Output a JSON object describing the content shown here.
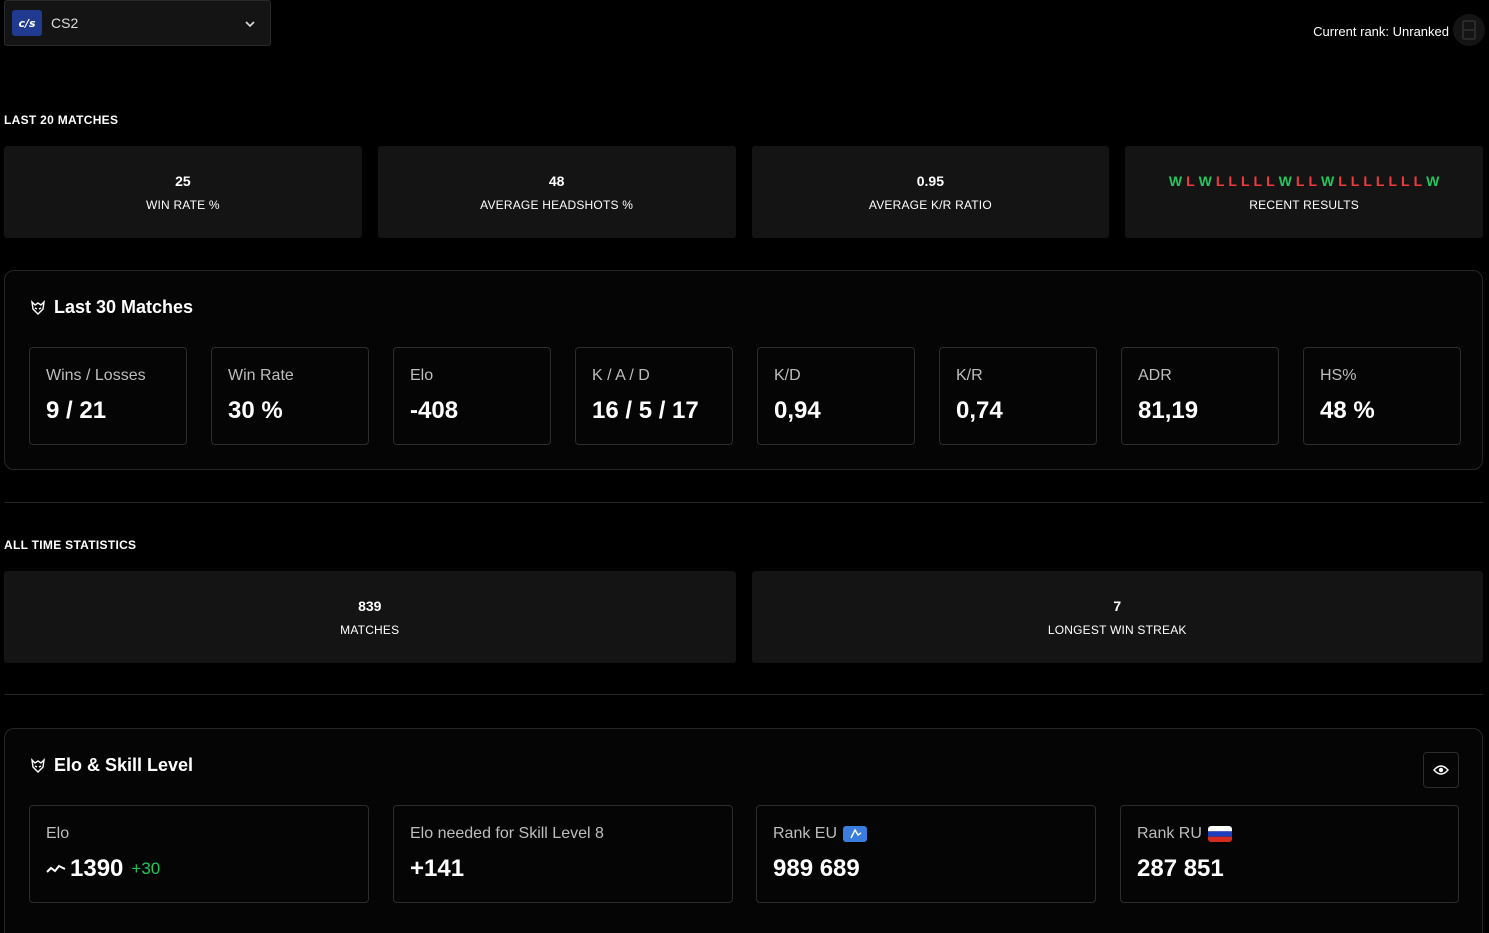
{
  "header": {
    "game_logo_text": "c/s",
    "game_name": "CS2",
    "current_rank_label": "Current rank: Unranked"
  },
  "last20": {
    "title": "LAST 20 MATCHES",
    "win_rate": {
      "value": "25",
      "label": "WIN RATE %"
    },
    "headshots": {
      "value": "48",
      "label": "AVERAGE HEADSHOTS %"
    },
    "kr_ratio": {
      "value": "0.95",
      "label": "AVERAGE K/R RATIO"
    },
    "recent": {
      "label": "RECENT RESULTS",
      "results": [
        "W",
        "L",
        "W",
        "L",
        "L",
        "L",
        "L",
        "L",
        "W",
        "L",
        "L",
        "W",
        "L",
        "L",
        "L",
        "L",
        "L",
        "L",
        "L",
        "W"
      ]
    }
  },
  "last30": {
    "title": "Last 30 Matches",
    "cards": [
      {
        "label": "Wins / Losses",
        "value": "9 / 21"
      },
      {
        "label": "Win Rate",
        "value": "30 %"
      },
      {
        "label": "Elo",
        "value": "-408"
      },
      {
        "label": "K / A / D",
        "value": "16 / 5 / 17"
      },
      {
        "label": "K/D",
        "value": "0,94"
      },
      {
        "label": "K/R",
        "value": "0,74"
      },
      {
        "label": "ADR",
        "value": "81,19"
      },
      {
        "label": "HS%",
        "value": "48 %"
      }
    ]
  },
  "alltime": {
    "title": "ALL TIME STATISTICS",
    "matches": {
      "value": "839",
      "label": "MATCHES"
    },
    "streak": {
      "value": "7",
      "label": "LONGEST WIN STREAK"
    }
  },
  "elo_skill": {
    "title": "Elo & Skill Level",
    "elo": {
      "label": "Elo",
      "value": "1390",
      "delta": "+30"
    },
    "needed": {
      "label": "Elo needed for Skill Level 8",
      "value": "+141"
    },
    "rank_eu": {
      "label": "Rank EU",
      "value": "989 689"
    },
    "rank_ru": {
      "label": "Rank RU",
      "value": "287 851"
    }
  },
  "colors": {
    "win": "#22c55e",
    "loss": "#ef3b3b",
    "card_bg": "#141414",
    "border": "#262626"
  }
}
